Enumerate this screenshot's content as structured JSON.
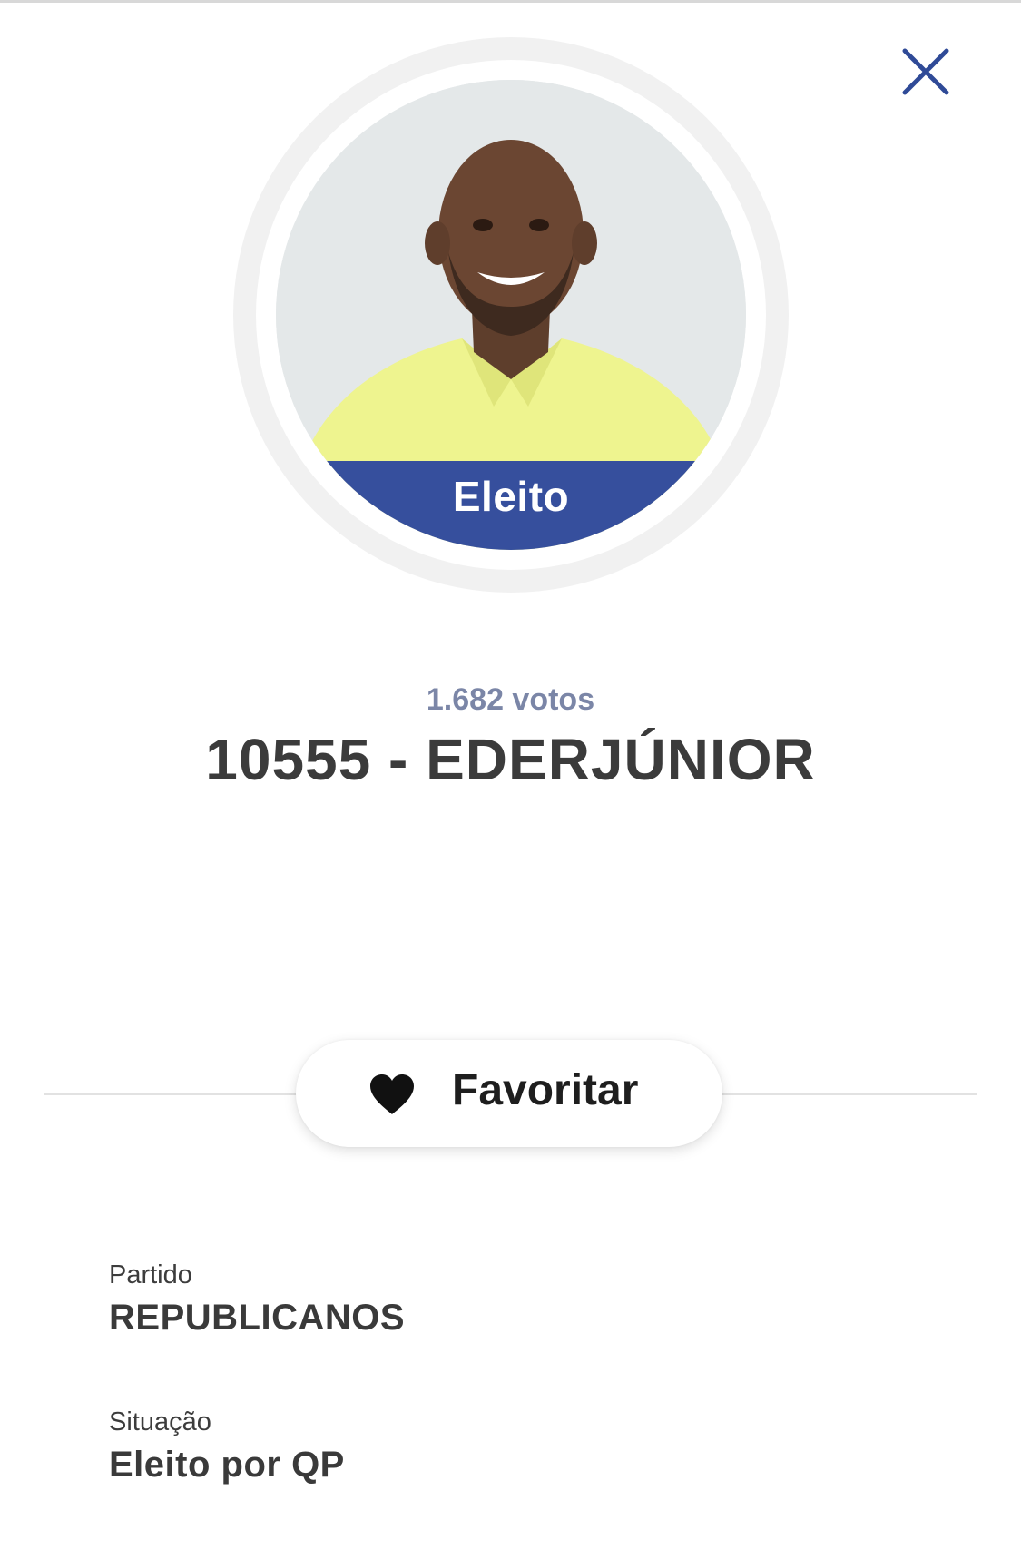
{
  "modal": {
    "close_icon": "close-icon"
  },
  "candidate": {
    "status_badge": "Eleito",
    "votes": "1.682 votos",
    "title": "10555 - EDERJÚNIOR"
  },
  "actions": {
    "favorite_label": "Favoritar",
    "favorite_icon": "heart-icon"
  },
  "details": {
    "party_label": "Partido",
    "party_value": "REPUBLICANOS",
    "situation_label": "Situação",
    "situation_value": "Eleito por QP"
  },
  "colors": {
    "accent": "#364f9d",
    "votes_text": "#7b86a7",
    "close_icon": "#2f4a97"
  }
}
